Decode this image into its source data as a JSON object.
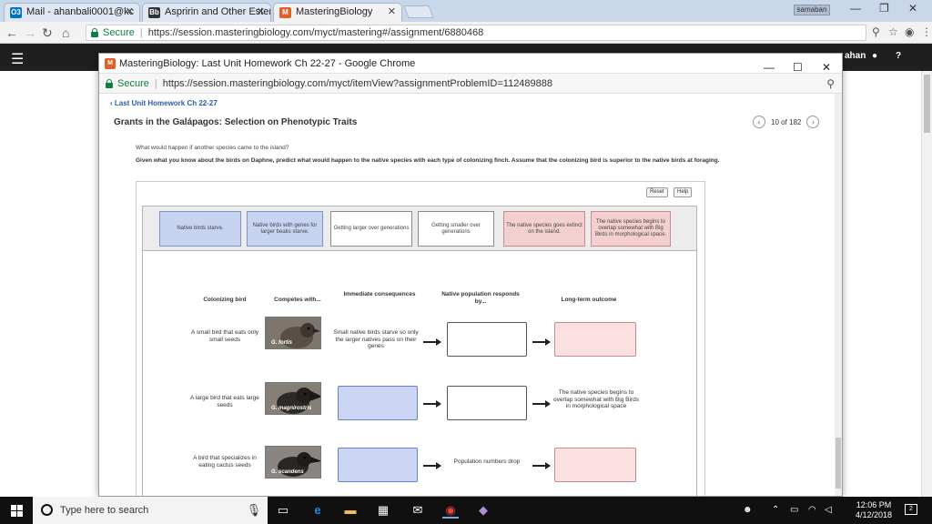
{
  "browser": {
    "tabs": [
      {
        "label": "Mail - ahanbali0001@kc",
        "favicon": "O3",
        "favicon_color": "#0072c6"
      },
      {
        "label": "Aspririn and Other Ester",
        "favicon": "Bb",
        "favicon_color": "#333333"
      },
      {
        "label": "MasteringBiology",
        "favicon": "M",
        "favicon_color": "#e35f2a"
      }
    ],
    "profile_badge": "samaban",
    "secure_label": "Secure",
    "url": "https://session.masteringbiology.com/myct/mastering#/assignment/6880468"
  },
  "app_nav": {
    "user_label": "ahan"
  },
  "popup": {
    "title": "MasteringBiology: Last Unit Homework Ch 22-27 - Google Chrome",
    "secure_label": "Secure",
    "url": "https://session.masteringbiology.com/myct/itemView?assignmentProblemID=112489888"
  },
  "page": {
    "back_link": "Last Unit Homework Ch 22-27",
    "title": "Grants in the Galápagos: Selection on Phenotypic Traits",
    "pager": "10 of 182",
    "question_intro": "What would happen if another species came to the island?",
    "question_main": "Given what you know about the birds on Daphne, predict what would happen to the native species with each type of colonizing finch. Assume that the colonizing bird is superior to the native birds at foraging.",
    "reset_label": "Reset",
    "help_label": "Help"
  },
  "label_cards": [
    {
      "text": "Native birds starve.",
      "type": "blue"
    },
    {
      "text": "Native birds with genes for larger beaks starve.",
      "type": "blue"
    },
    {
      "text": "Getting larger over generations",
      "type": "white"
    },
    {
      "text": "Getting smaller over generations",
      "type": "white"
    },
    {
      "text": "The native species goes extinct on the island.",
      "type": "pink"
    },
    {
      "text": "The native species begins to overlap somewhat with Big Birds in morphological space.",
      "type": "pink"
    }
  ],
  "table": {
    "headers": {
      "colonizing": "Colonizing bird",
      "competes": "Competes with...",
      "immediate": "Immediate consequences",
      "response": "Native population responds by...",
      "outcome": "Long-term outcome"
    },
    "rows": [
      {
        "bird": "A small bird that eats only small seeds",
        "species": "G. fortis",
        "immediate": "Small native birds starve so only the larger natives pass on their genes",
        "response": "",
        "outcome": ""
      },
      {
        "bird": "A large bird that eats large seeds",
        "species": "G. magnirostris",
        "immediate": "",
        "response": "",
        "outcome": "The native species begins to overlap somewhat with Big Birds in morphological space"
      },
      {
        "bird": "A bird that specializes in eating cactus seeds",
        "species": "G. scandens",
        "immediate": "",
        "response": "Population numbers drop",
        "outcome": ""
      }
    ]
  },
  "taskbar": {
    "search_placeholder": "Type here to search",
    "time": "12:06 PM",
    "date": "4/12/2018",
    "notification_count": "2"
  }
}
